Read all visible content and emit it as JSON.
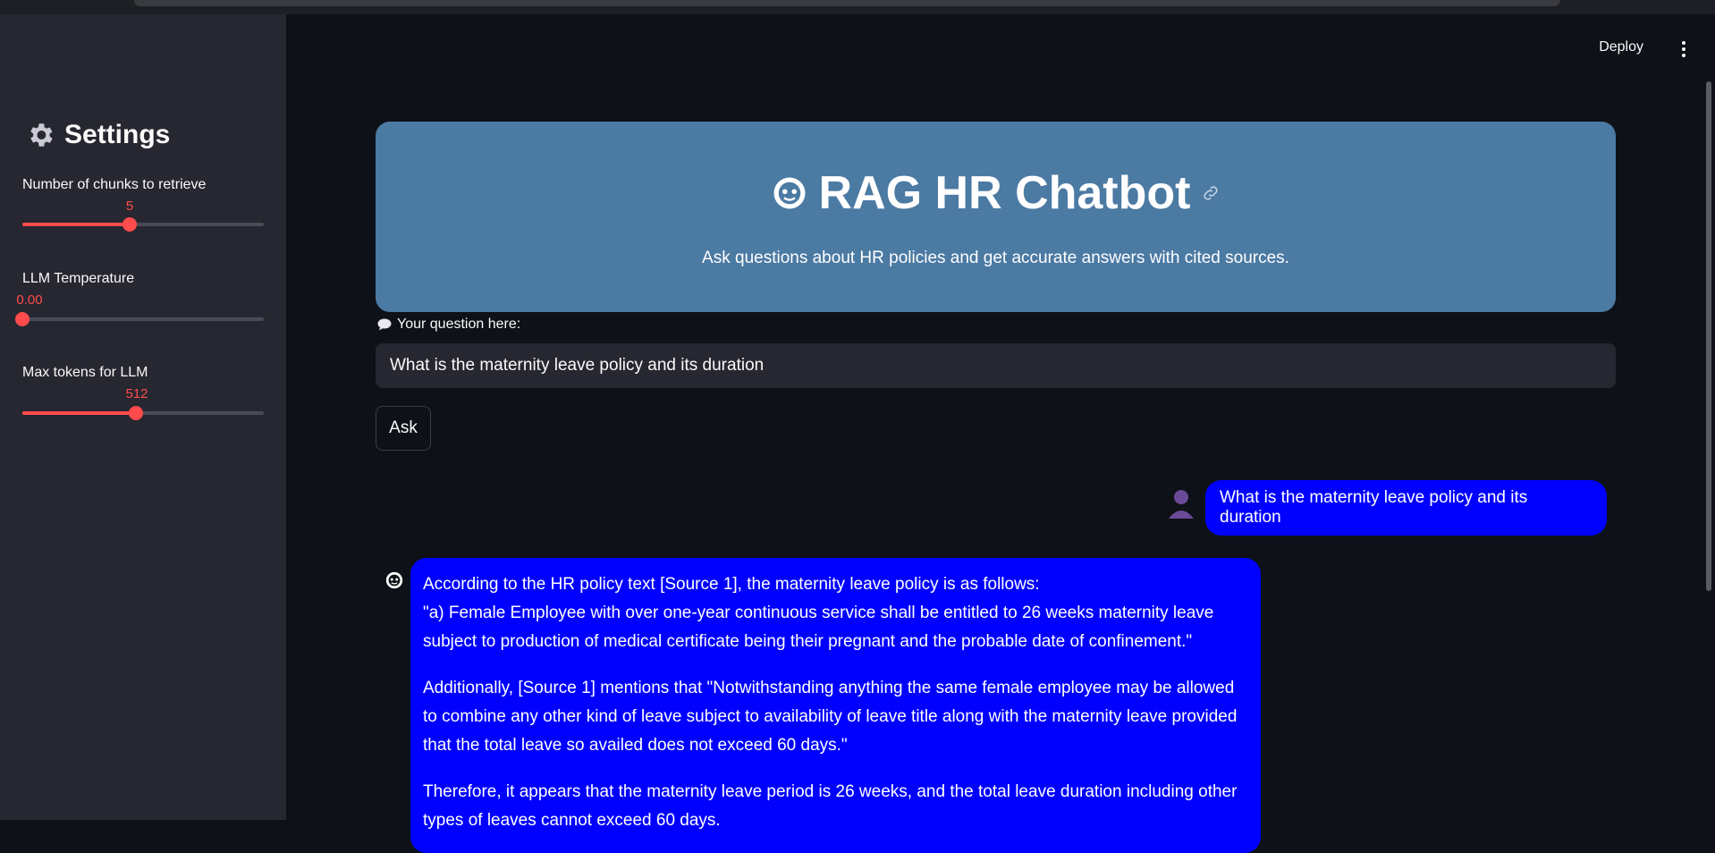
{
  "sidebar": {
    "title": "Settings",
    "title_icon": "gear-icon",
    "sliders": [
      {
        "label": "Number of chunks to retrieve",
        "value": "5",
        "fraction": 0.444
      },
      {
        "label": "LLM Temperature",
        "value": "0.00",
        "fraction": 0.0
      },
      {
        "label": "Max tokens for LLM",
        "value": "512",
        "fraction": 0.471
      }
    ],
    "accent_color": "#ff4b4b"
  },
  "topbar": {
    "deploy_label": "Deploy",
    "menu_icon": "kebab-menu-icon"
  },
  "hero": {
    "title": "RAG HR Chatbot",
    "title_icon": "robot-face-icon",
    "link_icon": "link-icon",
    "subtitle": "Ask questions about HR policies and get accurate answers with cited sources.",
    "background": "#4b7aa3"
  },
  "question": {
    "label": "Your question here:",
    "label_icon": "speech-bubble-icon",
    "value": "What is the maternity leave policy and its duration"
  },
  "ask_button_label": "Ask",
  "chat": {
    "bubble_color": "#0000ff",
    "user_message": "What is the maternity leave policy and its duration",
    "bot_paragraph_1_line_1": "According to the HR policy text [Source 1], the maternity leave policy is as follows:",
    "bot_paragraph_1_line_2": "\"a) Female Employee with over one-year continuous service shall be entitled to 26 weeks maternity leave subject to production of medical certificate being their pregnant and the probable date of confinement.\"",
    "bot_paragraph_2": "Additionally, [Source 1] mentions that \"Notwithstanding anything the same female employee may be allowed to combine any other kind of leave subject to availability of leave title along with the maternity leave provided that the total leave so availed does not exceed 60 days.\"",
    "bot_paragraph_3": "Therefore, it appears that the maternity leave period is 26 weeks, and the total leave duration including other types of leaves cannot exceed 60 days."
  }
}
